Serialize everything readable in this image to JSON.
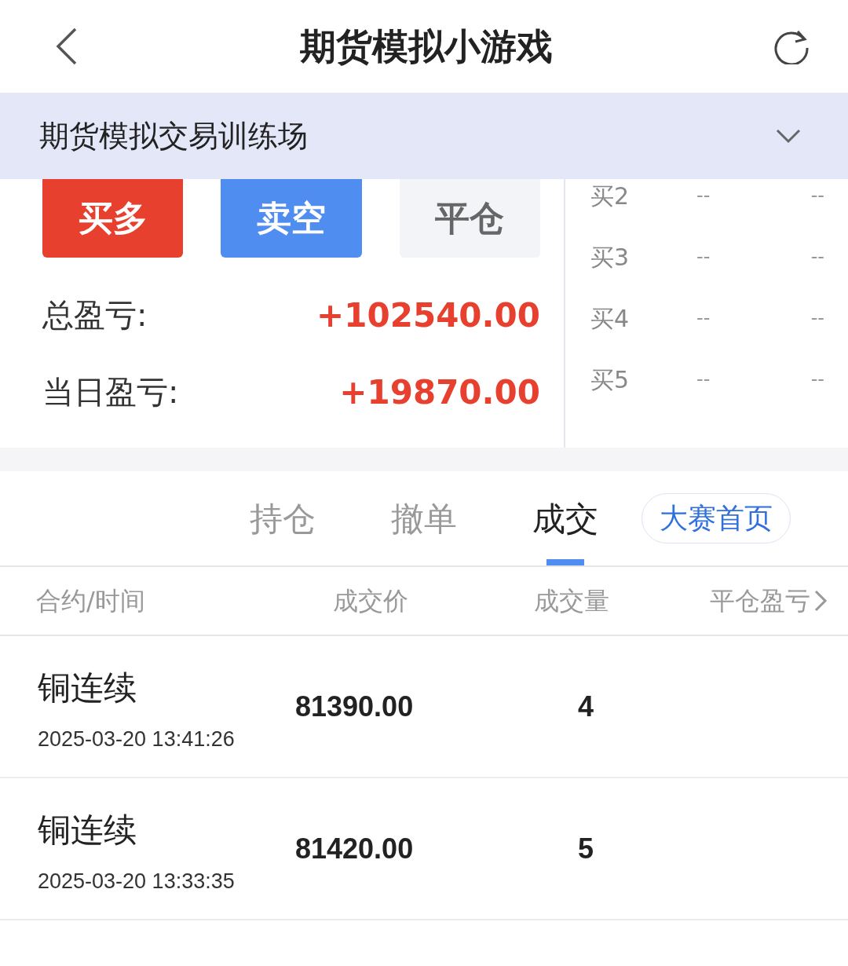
{
  "header": {
    "title": "期货模拟小游戏"
  },
  "banner": {
    "title": "期货模拟交易训练场",
    "expanded": false
  },
  "actions": [
    {
      "label": "买多",
      "kind": "buy"
    },
    {
      "label": "卖空",
      "kind": "sell"
    },
    {
      "label": "平仓",
      "kind": "close"
    }
  ],
  "summary": [
    {
      "label": "总盈亏:",
      "value": "+102540.00"
    },
    {
      "label": "当日盈亏:",
      "value": "+19870.00"
    }
  ],
  "order_book": [
    {
      "label": "买2",
      "price": "--",
      "volume": "--"
    },
    {
      "label": "买3",
      "price": "--",
      "volume": "--"
    },
    {
      "label": "买4",
      "price": "--",
      "volume": "--"
    },
    {
      "label": "买5",
      "price": "--",
      "volume": "--"
    }
  ],
  "tabs": [
    {
      "label": "持仓",
      "selected": false
    },
    {
      "label": "撤单",
      "selected": false
    },
    {
      "label": "成交",
      "selected": true
    }
  ],
  "contest_button": "大赛首页",
  "table": {
    "columns": [
      "合约/时间",
      "成交价",
      "成交量",
      "平仓盈亏"
    ],
    "rows": [
      {
        "contract": "铜连续",
        "time": "2025-03-20 13:41:26",
        "price": "81390.00",
        "volume": "4"
      },
      {
        "contract": "铜连续",
        "time": "2025-03-20 13:33:35",
        "price": "81420.00",
        "volume": "5"
      }
    ]
  }
}
